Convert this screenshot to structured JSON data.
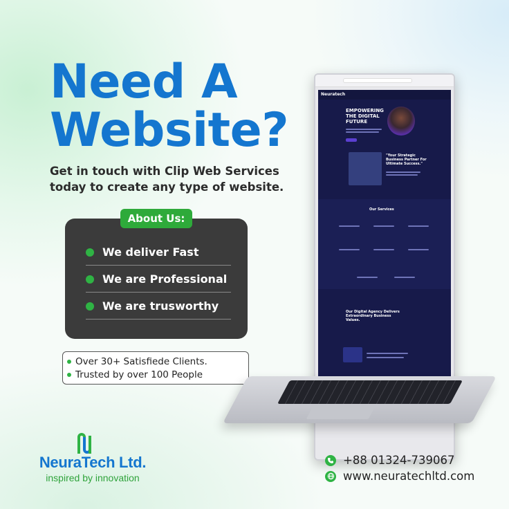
{
  "headline": {
    "line1": "Need A",
    "line2": "Website?"
  },
  "subtitle": "Get in touch with Clip Web Services today to create any type of website.",
  "about": {
    "badge": "About Us:",
    "items": [
      "We deliver Fast",
      "We are Professional",
      "We are trusworthy"
    ]
  },
  "stats": [
    "Over 30+ Satisfiede Clients.",
    "Trusted by over 100 People"
  ],
  "brand": {
    "name": "NeuraTech Ltd.",
    "tagline": "inspired by innovation"
  },
  "contact": {
    "phone": "+88 01324-739067",
    "website": "www.neuratechltd.com"
  },
  "mockup": {
    "site_logo": "Neuratech",
    "hero_title": "EMPOWERING THE DIGITAL FUTURE",
    "quote_title": "\"Your Strategic Business Partner For Ultimate Success.\"",
    "services_title": "Our Services",
    "agency_title": "Our Digital Agency Delivers Extraordinary Business Values."
  },
  "colors": {
    "headline": "#1476cf",
    "accent_green": "#2fb344",
    "card": "#3b3b3b"
  },
  "icons": {
    "phone": "phone-icon",
    "web": "globe-icon"
  }
}
